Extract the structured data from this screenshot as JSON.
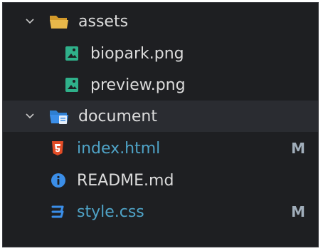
{
  "explorer": {
    "items": [
      {
        "label": "assets",
        "type": "folder",
        "expanded": true,
        "icon": "folder-open-icon"
      },
      {
        "label": "biopark.png",
        "type": "file",
        "icon": "image-file-icon"
      },
      {
        "label": "preview.png",
        "type": "file",
        "icon": "image-file-icon"
      },
      {
        "label": "document",
        "type": "folder",
        "expanded": true,
        "icon": "folder-blue-icon"
      },
      {
        "label": "index.html",
        "type": "file",
        "icon": "html5-icon",
        "status": "M"
      },
      {
        "label": "README.md",
        "type": "file",
        "icon": "info-icon"
      },
      {
        "label": "style.css",
        "type": "file",
        "icon": "css3-icon",
        "status": "M"
      }
    ]
  },
  "colors": {
    "background": "#1e1f22",
    "active_row": "#2a2c31",
    "modified_text": "#4fa3c7",
    "badge": "#a1aebb",
    "folder": "#e8b84a",
    "image_icon": "#2fb08a",
    "html_icon": "#e34c26",
    "css_icon": "#3b8ee8",
    "info_icon": "#3b8ee8"
  }
}
